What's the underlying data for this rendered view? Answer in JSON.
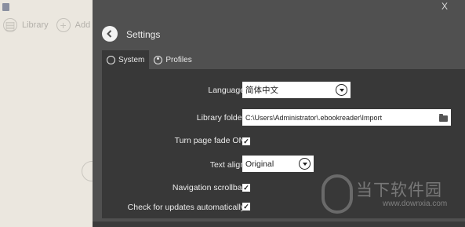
{
  "background": {
    "toolbar": {
      "library_label": "Library",
      "add_label": "Add boo"
    }
  },
  "panel": {
    "close_label": "X",
    "title": "Settings",
    "tabs": [
      {
        "label": "System",
        "active": true
      },
      {
        "label": "Profiles",
        "active": false
      }
    ]
  },
  "settings": {
    "language": {
      "label": "Language:",
      "value": "简体中文"
    },
    "library_folder": {
      "label": "Library folder:",
      "value": "C:\\Users\\Administrator\\.ebookreader\\Import"
    },
    "turn_page_fade": {
      "label": "Turn page fade ON:",
      "checked": true
    },
    "text_align": {
      "label": "Text align:",
      "value": "Original"
    },
    "navigation_scrollbar": {
      "label": "Navigation scrollbar:",
      "checked": true
    },
    "check_updates": {
      "label": "Check for updates automatically:",
      "checked": true
    }
  },
  "watermark": {
    "text": "当下软件园",
    "url": "www.downxia.com"
  },
  "colors": {
    "panel_bg": "#505050",
    "content_bg": "#383838",
    "left_bg": "#ebe7df"
  }
}
